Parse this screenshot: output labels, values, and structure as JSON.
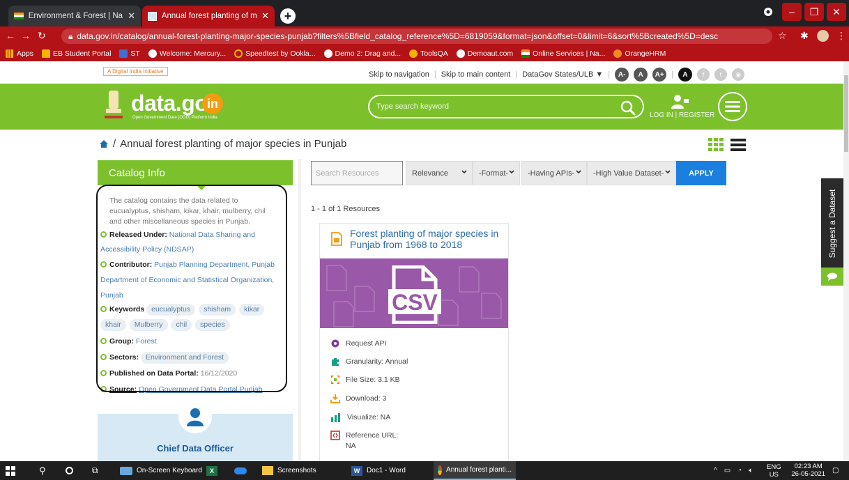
{
  "browser": {
    "tabs": [
      {
        "label": "Environment & Forest | National",
        "active": false
      },
      {
        "label": "Annual forest planting of major s",
        "active": true
      }
    ],
    "url": "data.gov.in/catalog/annual-forest-planting-major-species-punjab?filters%5Bfield_catalog_reference%5D=6819059&format=json&offset=0&limit=6&sort%5Bcreated%5D=desc",
    "bookmarks": [
      "Apps",
      "EB Student Portal",
      "ST",
      "Welcome: Mercury...",
      "Speedtest by Ookla...",
      "Demo 2: Drag and...",
      "ToolsQA",
      "Demoaut.com",
      "Online Services | Na...",
      "OrangeHRM"
    ]
  },
  "topbar": {
    "digital_india": "A Digital India Initiative",
    "skip_nav": "Skip to navigation",
    "skip_main": "Skip to main content",
    "states": "DataGov States/ULB",
    "font_minus": "A-",
    "font_normal": "A",
    "font_plus": "A+",
    "contrast": "A"
  },
  "header": {
    "logo": "data.gov",
    "logo_suffix": "in",
    "logo_sub": "Open Government Data (OGD) Platform India",
    "search_placeholder": "Type search keyword",
    "login": "LOG IN | REGISTER"
  },
  "breadcrumb": {
    "sep": "/",
    "title": "Annual forest planting of major species in Punjab"
  },
  "catalog": {
    "heading": "Catalog Info",
    "description": "The catalog contains the data related to eucualyptus, shisham, kikar, khair, mulberry, chil and other miscellaneous species in Punjab.",
    "released_label": "Released Under:",
    "released_value": "National Data Sharing and Accessibility Policy (NDSAP)",
    "contributor_label": "Contributor:",
    "contributor_value": "Punjab Planning Department, Punjab Department of Economic and Statistical Organization, Punjab",
    "keywords_label": "Keywords",
    "keywords": [
      "eucualyptus",
      "shisham",
      "kikar",
      "khair",
      "Mulberry",
      "chil",
      "species"
    ],
    "group_label": "Group:",
    "group_value": "Forest",
    "sectors_label": "Sectors:",
    "sectors_value": "Environment and Forest",
    "published_label": "Published on Data Portal:",
    "published_value": "16/12/2020",
    "source_label": "Source:",
    "source_value": "Open Government Data Portal Punjab",
    "cdo": "Chief Data Officer"
  },
  "filters": {
    "search_placeholder": "Search Resources",
    "sort": "Relevance",
    "format": "-Format-",
    "apis": "-Having APIs-",
    "hvd": "-High Value Dataset-",
    "apply": "APPLY"
  },
  "results": {
    "count": "1 - 1 of 1 Resources",
    "card": {
      "title": "Forest planting of major species in Punjab from 1968 to 2018",
      "badge": "CSV",
      "request_api": "Request API",
      "granularity": "Granularity: Annual",
      "file_size": "File Size: 3.1 KB",
      "download": "Download: 3",
      "visualize": "Visualize: NA",
      "reference_label": "Reference URL:",
      "reference_value": "NA"
    }
  },
  "suggest": "Suggest a Dataset",
  "taskbar": {
    "items": [
      "On-Screen Keyboard",
      "Screenshots",
      "Doc1 - Word",
      "Annual forest planti..."
    ],
    "lang": "ENG",
    "region": "US",
    "time": "02:23 AM",
    "date": "26-05-2021"
  },
  "colors": {
    "brand_green": "#7cc12c",
    "browser_red": "#b31217",
    "link_blue": "#2d6ea8",
    "apply_blue": "#1b7fe0",
    "csv_purple": "#9a58a8"
  }
}
